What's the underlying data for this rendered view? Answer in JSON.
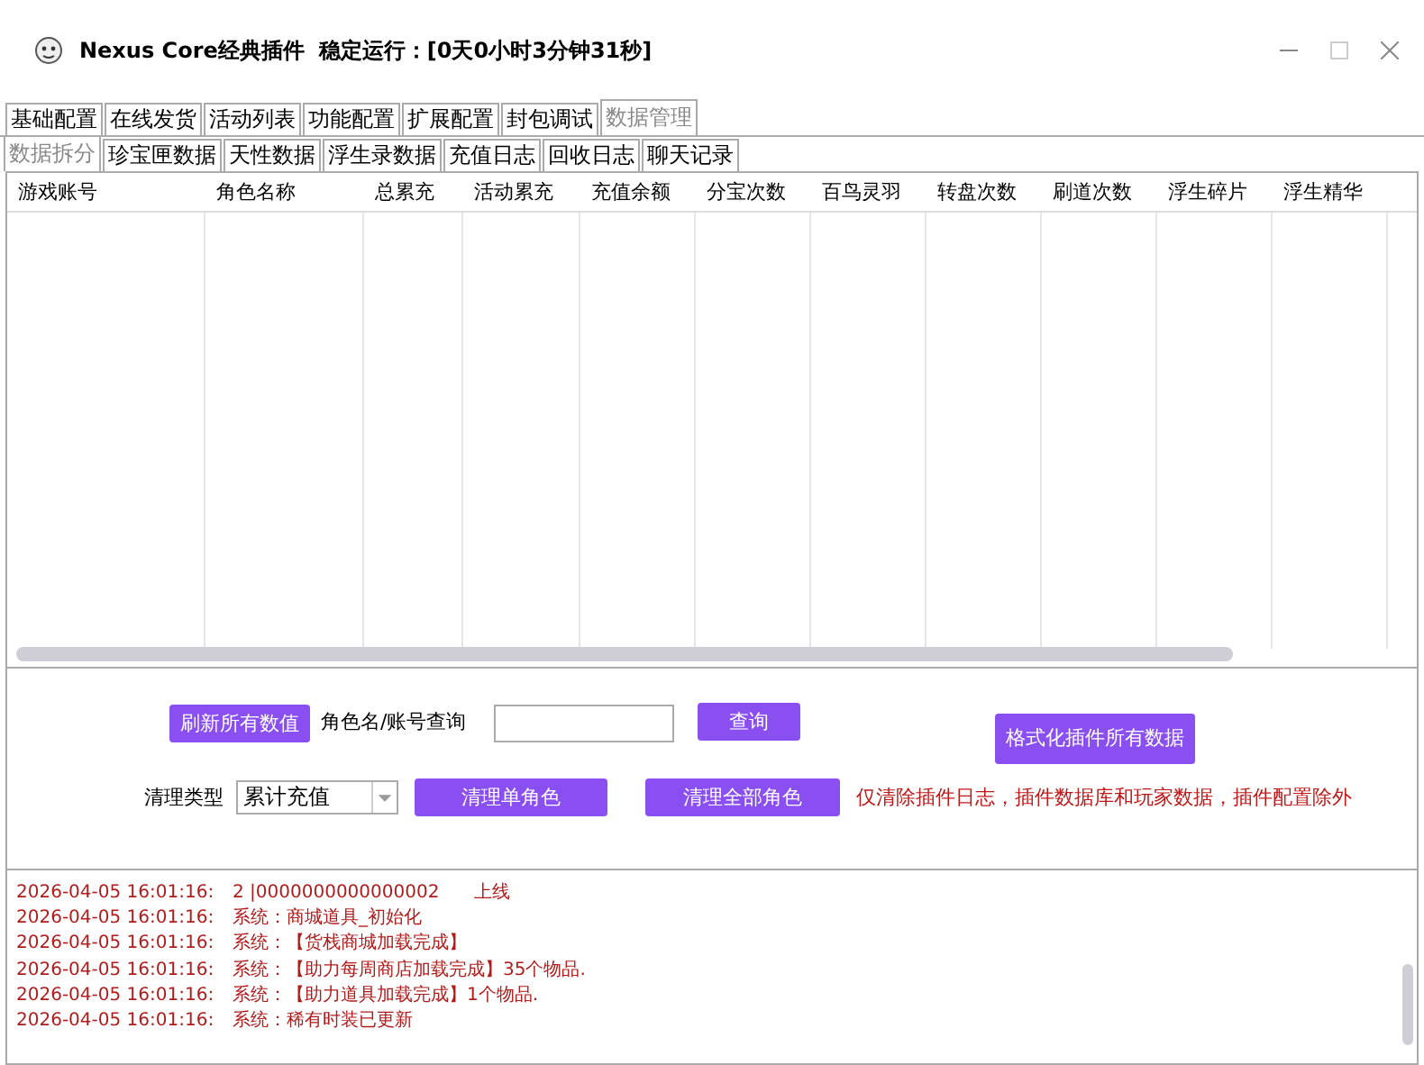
{
  "window": {
    "title": "Nexus Core经典插件",
    "uptime": "稳定运行：[0天0小时3分钟31秒]"
  },
  "tabs": [
    {
      "label": "基础配置",
      "selected": false
    },
    {
      "label": "在线发货",
      "selected": false
    },
    {
      "label": "活动列表",
      "selected": false
    },
    {
      "label": "功能配置",
      "selected": false
    },
    {
      "label": "扩展配置",
      "selected": false
    },
    {
      "label": "封包调试",
      "selected": false
    },
    {
      "label": "数据管理",
      "selected": true
    }
  ],
  "subtabs": [
    {
      "label": "数据拆分",
      "selected": true
    },
    {
      "label": "珍宝匣数据",
      "selected": false
    },
    {
      "label": "天性数据",
      "selected": false
    },
    {
      "label": "浮生录数据",
      "selected": false
    },
    {
      "label": "充值日志",
      "selected": false
    },
    {
      "label": "回收日志",
      "selected": false
    },
    {
      "label": "聊天记录",
      "selected": false
    }
  ],
  "table": {
    "columns": [
      "游戏账号",
      "角色名称",
      "总累充",
      "活动累充",
      "充值余额",
      "分宝次数",
      "百鸟灵羽",
      "转盘次数",
      "刷道次数",
      "浮生碎片",
      "浮生精华"
    ]
  },
  "controls": {
    "refresh_button": "刷新所有数值",
    "query_label": "角色名/账号查询",
    "query_button": "查询",
    "format_button": "格式化插件所有数据",
    "clean_type_label": "清理类型",
    "clean_type_value": "累计充值",
    "clean_one_button": "清理单角色",
    "clean_all_button": "清理全部角色",
    "warning": "仅清除插件日志，插件数据库和玩家数据，插件配置除外"
  },
  "log": [
    {
      "time": "2026-04-05 16:01:16:",
      "message": "2 |0000000000000002      上线"
    },
    {
      "time": "2026-04-05 16:01:16:",
      "message": "系统：商城道具_初始化"
    },
    {
      "time": "2026-04-05 16:01:16:",
      "message": "系统：【货栈商城加载完成】"
    },
    {
      "time": "2026-04-05 16:01:16:",
      "message": "系统：【助力每周商店加载完成】35个物品."
    },
    {
      "time": "2026-04-05 16:01:16:",
      "message": "系统：【助力道具加载完成】1个物品."
    },
    {
      "time": "2026-04-05 16:01:16:",
      "message": "系统：稀有时装已更新"
    }
  ]
}
